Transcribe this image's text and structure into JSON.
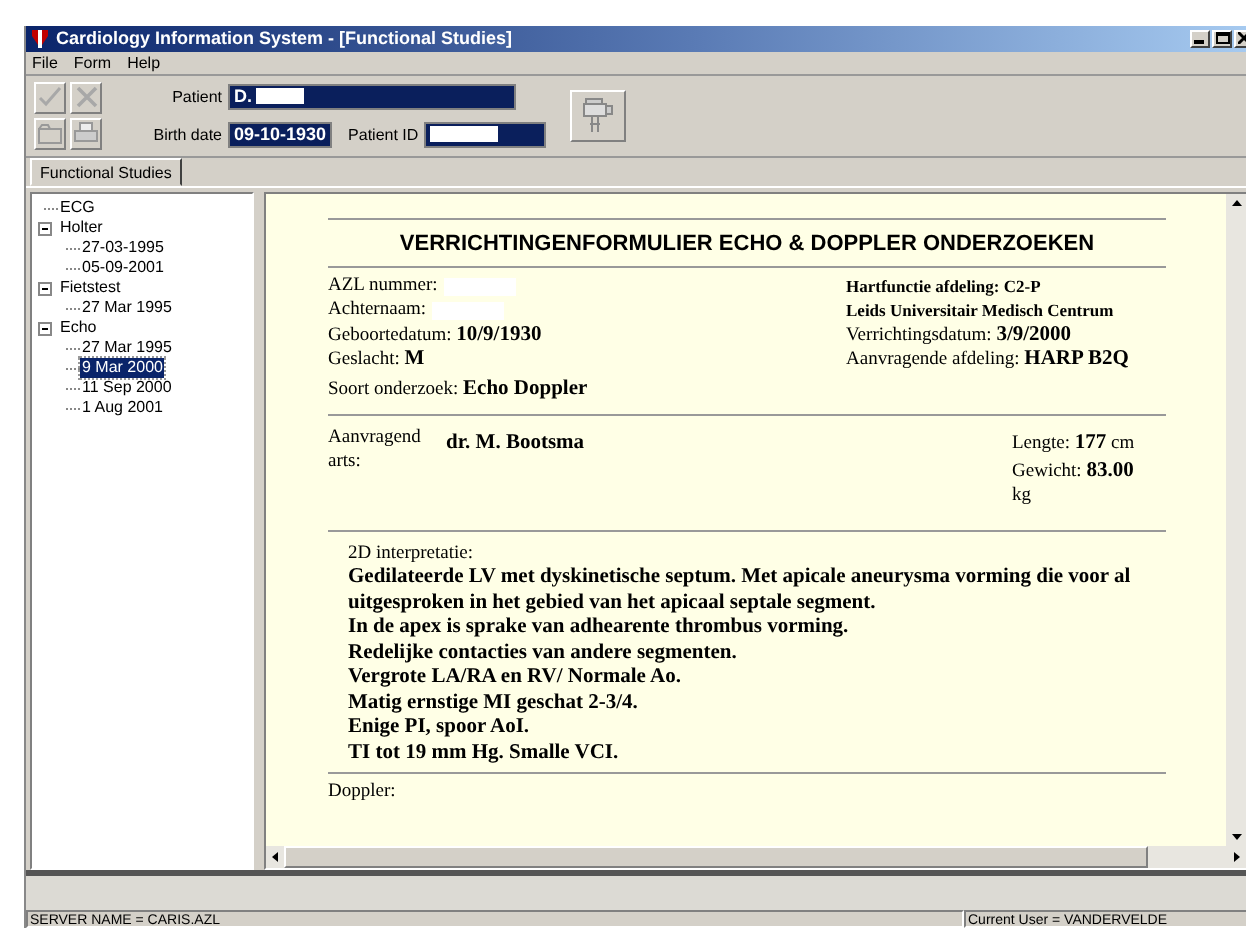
{
  "window": {
    "title": "Cardiology Information System - [Functional Studies]"
  },
  "menu": [
    {
      "label": "File"
    },
    {
      "label": "Form"
    },
    {
      "label": "Help"
    }
  ],
  "patient": {
    "patient_label": "Patient",
    "patient_value": "D.",
    "birth_date_label": "Birth date",
    "birth_date": "09-10-1930",
    "patient_id_label": "Patient ID"
  },
  "tabs": [
    {
      "label": "Functional Studies",
      "selected": true
    }
  ],
  "tree": [
    {
      "label": "ECG",
      "selected": false
    },
    {
      "label": "Holter",
      "selected": false,
      "expanded": true,
      "children": [
        {
          "label": "27-03-1995",
          "selected": false
        },
        {
          "label": "05-09-2001",
          "selected": false
        }
      ]
    },
    {
      "label": "Fietstest",
      "selected": false,
      "expanded": true,
      "children": [
        {
          "label": "27 Mar 1995",
          "selected": false
        }
      ]
    },
    {
      "label": "Echo",
      "selected": false,
      "expanded": true,
      "children": [
        {
          "label": "27 Mar 1995",
          "selected": false
        },
        {
          "label": "9 Mar 2000",
          "selected": true
        },
        {
          "label": "11 Sep 2000",
          "selected": false
        },
        {
          "label": "1 Aug 2001",
          "selected": false
        }
      ]
    }
  ],
  "report": {
    "title": "VERRICHTINGENFORMULIER ECHO & DOPPLER ONDERZOEKEN",
    "left_fields": [
      {
        "text": "AZL nummer:",
        "redacted": true
      },
      {
        "text": "Achternaam:",
        "redacted": true
      },
      {
        "text": "Geboortedatum: **10/9/1930**",
        "redacted": false
      },
      {
        "text": "Geslacht: **M**",
        "redacted": false
      }
    ],
    "right_fields": [
      {
        "text": "Hartfunctie afdeling: C2-P",
        "kind": "heading"
      },
      {
        "text": "Leids Universitair Medisch Centrum",
        "kind": "heading"
      },
      {
        "text": "Verrichtingsdatum: **3/9/2000**",
        "kind": "field"
      },
      {
        "text": "Aanvragende afdeling: **HARP B2Q**",
        "kind": "field"
      }
    ],
    "exam_type": "Soort onderzoek: **Echo Doppler**",
    "requesting_label": "Aanvragend arts:",
    "requesting_doctor": "dr. M. Bootsma",
    "length": "Lengte: **177** cm",
    "weight": "Gewicht: **83.00** kg",
    "interpretation_label": "2D interpretatie:",
    "interpretation": [
      "Gedilateerde LV met dyskinetische septum. Met apicale aneurysma vorming die voor al uitgesproken in het gebied van het apicaal septale segment.",
      "In de apex is sprake van adhearente thrombus vorming.",
      "Redelijke contacties van andere segmenten.",
      "Vergrote LA/RA en RV/ Normale Ao.",
      "Matig ernstige MI geschat 2-3/4.",
      "Enige PI, spoor AoI.",
      "TI tot 19 mm Hg. Smalle VCI."
    ],
    "doppler_label": "Doppler:"
  },
  "status_bar": [
    {
      "text": "SERVER NAME = CARIS.AZL"
    },
    {
      "text": "Current User = VANDERVELDE"
    }
  ]
}
